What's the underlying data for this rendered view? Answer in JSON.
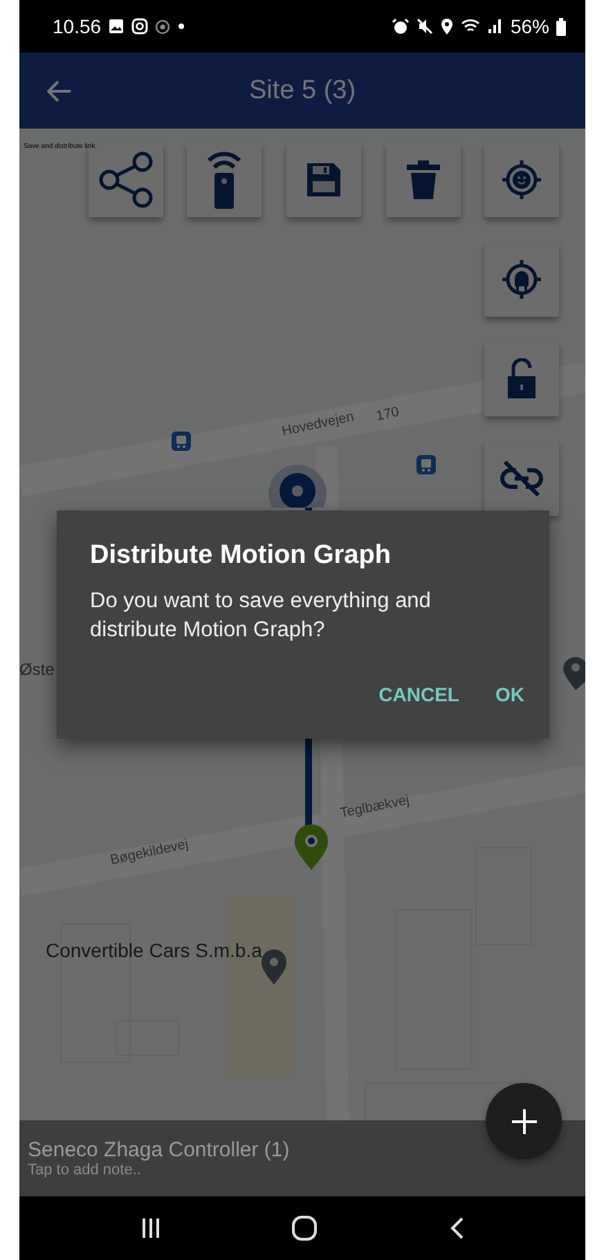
{
  "status_bar": {
    "time": "10.56",
    "battery": "56%"
  },
  "app_bar": {
    "title": "Site 5 (3)"
  },
  "map_hint": "Save and distribute link.",
  "map_labels": [
    {
      "text": "Hovedvejen"
    },
    {
      "text": "170"
    },
    {
      "text": "Øste"
    },
    {
      "text": "Teglbækvej"
    },
    {
      "text": "Bøgekildevej"
    },
    {
      "text": "Convertible Cars S.m.b.a"
    }
  ],
  "dialog": {
    "title": "Distribute Motion Graph",
    "message": "Do you want to save everything and distribute Motion Graph?",
    "buttons": [
      "CANCEL",
      "OK"
    ]
  },
  "note_bar": {
    "title": "Seneco Zhaga Controller (1)",
    "subtitle": "Tap to add note.."
  }
}
